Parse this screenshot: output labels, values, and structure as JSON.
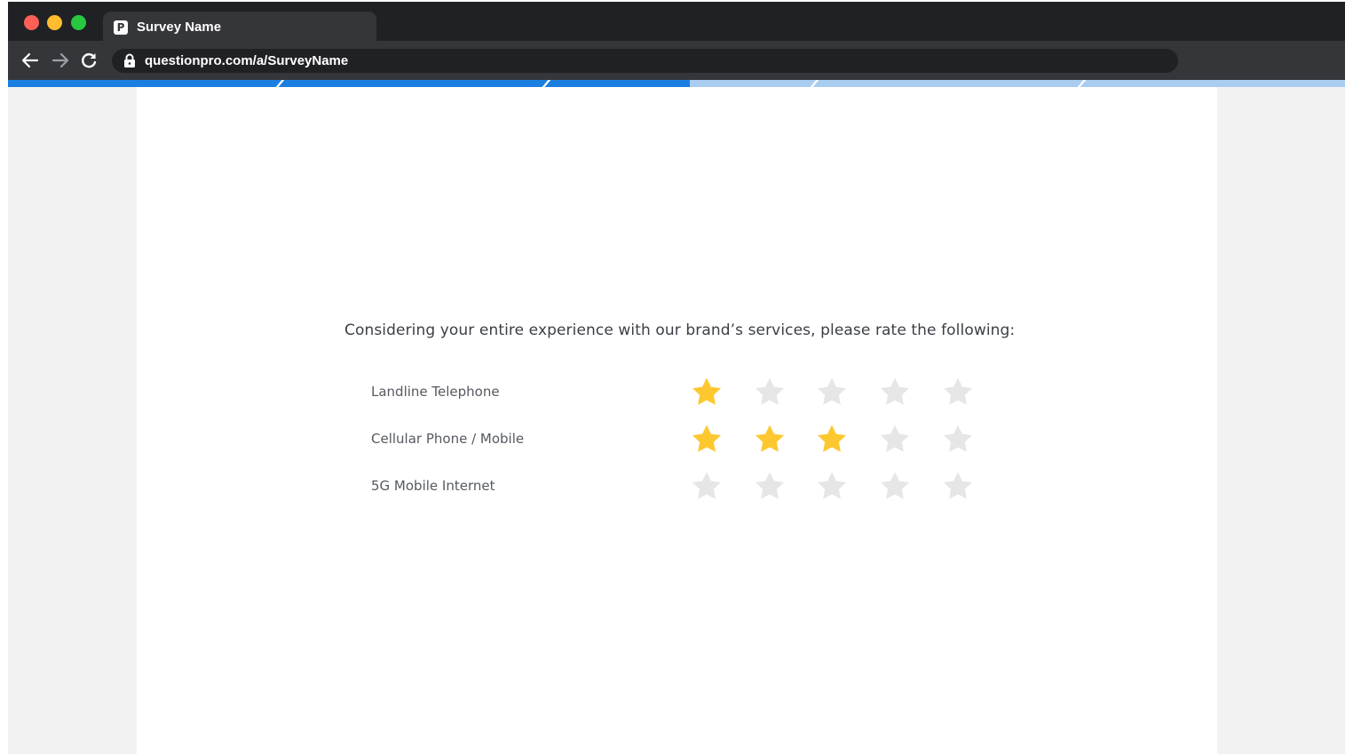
{
  "browser": {
    "tab_title": "Survey Name",
    "tab_favicon": "questionpro-icon",
    "url": "questionpro.com/a/SurveyName",
    "traffic_lights": {
      "close": "#ff5f57",
      "minimize": "#febc2e",
      "maximize": "#28c840"
    }
  },
  "progress": {
    "fraction": 0.51,
    "fill_color": "#1a7fe0",
    "track_color": "#a9cdf0"
  },
  "survey": {
    "question": "Considering your entire experience with our brand’s services, please rate the following:",
    "max_stars": 5,
    "star_filled_color": "#fdc82f",
    "star_empty_color": "#e6e6e6",
    "rows": [
      {
        "label": "Landline Telephone",
        "rating": 1
      },
      {
        "label": "Cellular Phone / Mobile",
        "rating": 3
      },
      {
        "label": "5G Mobile Internet",
        "rating": 0
      }
    ]
  }
}
